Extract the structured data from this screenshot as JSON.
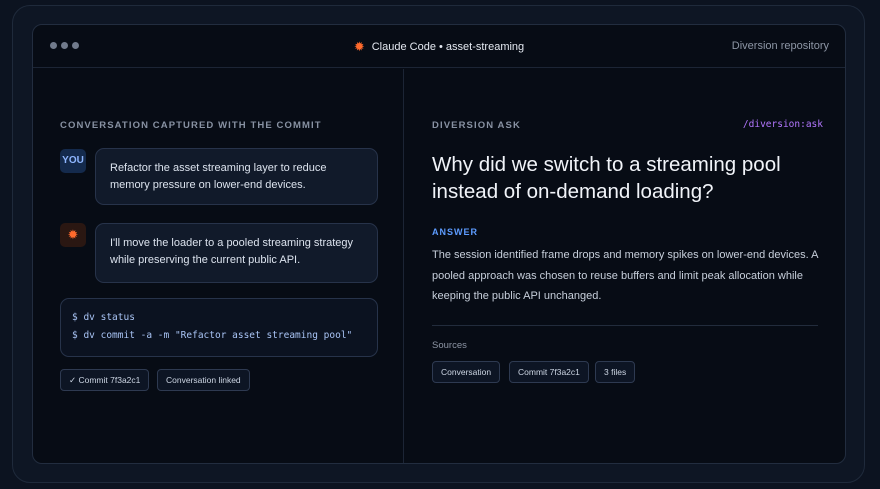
{
  "window": {
    "title": "Claude Code • asset-streaming",
    "title_icon": "claude-sparkle-icon",
    "repo_link": "Diversion repository"
  },
  "left": {
    "section_label": "CONVERSATION CAPTURED WITH THE COMMIT",
    "user_avatar": "YOU",
    "user_message": "Refactor the asset streaming layer to reduce memory pressure on lower-end devices.",
    "assistant_avatar_icon": "claude-sparkle-icon",
    "assistant_message": "I'll move the loader to a pooled streaming strategy while preserving the current public API.",
    "terminal": [
      "$ dv status",
      "$ dv commit -a -m \"Refactor asset streaming pool\""
    ],
    "chips": [
      "✓ Commit 7f3a2c1",
      "Conversation linked"
    ]
  },
  "right": {
    "section_label": "DIVERSION ASK",
    "command": "/diversion:ask",
    "question": "Why did we switch to a streaming pool instead of on-demand loading?",
    "answer_label": "ANSWER",
    "answer": "The session identified frame drops and memory spikes on lower-end devices. A pooled approach was chosen to reuse buffers and limit peak allocation while keeping the public API unchanged.",
    "sources_label": "Sources",
    "sources": [
      "Conversation",
      "Commit 7f3a2c1",
      "3 files"
    ]
  },
  "colors": {
    "accent_orange": "#ff6a2c",
    "accent_blue": "#5d9cff",
    "accent_purple": "#b377ff",
    "background": "#070c15"
  }
}
